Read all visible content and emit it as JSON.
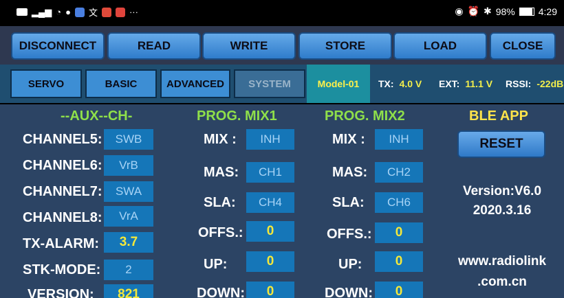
{
  "status_bar": {
    "left_indicators": [
      "hd-icon",
      "signal-icon",
      "wifi-icon",
      "chat-icon",
      "app-icon",
      "translate-icon",
      "app-icon-2",
      "app-icon-3"
    ],
    "more": "···",
    "battery": "98%",
    "time": "4:29"
  },
  "nav": {
    "disconnect": "DISCONNECT",
    "read": "READ",
    "write": "WRITE",
    "store": "STORE",
    "load": "LOAD",
    "close": "CLOSE"
  },
  "tabs": {
    "servo": "SERVO",
    "basic": "BASIC",
    "advanced": "ADVANCED",
    "system": "SYSTEM",
    "model": "Model-01"
  },
  "telemetry": {
    "tx_label": "TX:",
    "tx_value": "4.0 V",
    "ext_label": "EXT:",
    "ext_value": "11.1 V",
    "rssi_label": "RSSI:",
    "rssi_value": "-22dBm"
  },
  "aux": {
    "title": "--AUX--CH-",
    "rows": [
      {
        "label": "CHANNEL5:",
        "value": "SWB"
      },
      {
        "label": "CHANNEL6:",
        "value": "VrB"
      },
      {
        "label": "CHANNEL7:",
        "value": "SWA"
      },
      {
        "label": "CHANNEL8:",
        "value": "VrA"
      },
      {
        "label": "TX-ALARM:",
        "value": "3.7"
      },
      {
        "label": "STK-MODE:",
        "value": "2"
      },
      {
        "label": "VERSION:",
        "value": "821"
      }
    ]
  },
  "mix1": {
    "title": "PROG. MIX1",
    "mix_label": "MIX :",
    "mix_value": "INH",
    "mas_label": "MAS:",
    "mas_value": "CH1",
    "sla_label": "SLA:",
    "sla_value": "CH4",
    "offs_label": "OFFS.:",
    "offs_value": "0",
    "up_label": "UP:",
    "up_value": "0",
    "down_label": "DOWN:",
    "down_value": "0"
  },
  "mix2": {
    "title": "PROG. MIX2",
    "mix_label": "MIX :",
    "mix_value": "INH",
    "mas_label": "MAS:",
    "mas_value": "CH2",
    "sla_label": "SLA:",
    "sla_value": "CH6",
    "offs_label": "OFFS.:",
    "offs_value": "0",
    "up_label": "UP:",
    "up_value": "0",
    "down_label": "DOWN:",
    "down_value": "0"
  },
  "ble": {
    "title": "BLE APP",
    "reset": "RESET",
    "version": "Version:V6.0",
    "date": "2020.3.16",
    "url_line1": "www.radiolink",
    "url_line2": ".com.cn"
  },
  "colors": {
    "title_green": "#8fe04a",
    "title_yellow": "#ffe44a",
    "value_yellow": "#f4e83a",
    "panel_bg": "#2c4464",
    "button_blue": "#3d8ed4"
  }
}
